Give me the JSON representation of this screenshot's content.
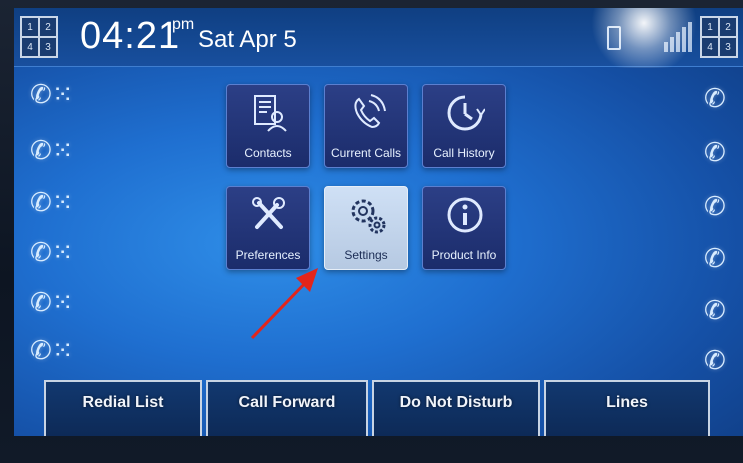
{
  "status_bar": {
    "left_lines": [
      "1",
      "2",
      "4",
      "3"
    ],
    "right_lines": [
      "1",
      "2",
      "4",
      "3"
    ],
    "time": "04:21",
    "ampm": "pm",
    "date": "Sat Apr 5"
  },
  "menu": {
    "tiles": [
      {
        "label": "Contacts",
        "icon": "contacts-icon"
      },
      {
        "label": "Current Calls",
        "icon": "current-calls-icon"
      },
      {
        "label": "Call History",
        "icon": "call-history-icon"
      },
      {
        "label": "Preferences",
        "icon": "preferences-icon"
      },
      {
        "label": "Settings",
        "icon": "settings-icon",
        "selected": true
      },
      {
        "label": "Product Info",
        "icon": "info-icon"
      }
    ]
  },
  "softkeys": [
    "Redial List",
    "Call Forward",
    "Do Not Disturb",
    "Lines"
  ],
  "colors": {
    "screen": "#1f6fd0",
    "tile": "#24357a",
    "selected_tile": "#c6d7ee",
    "arrow": "#e3251b"
  }
}
